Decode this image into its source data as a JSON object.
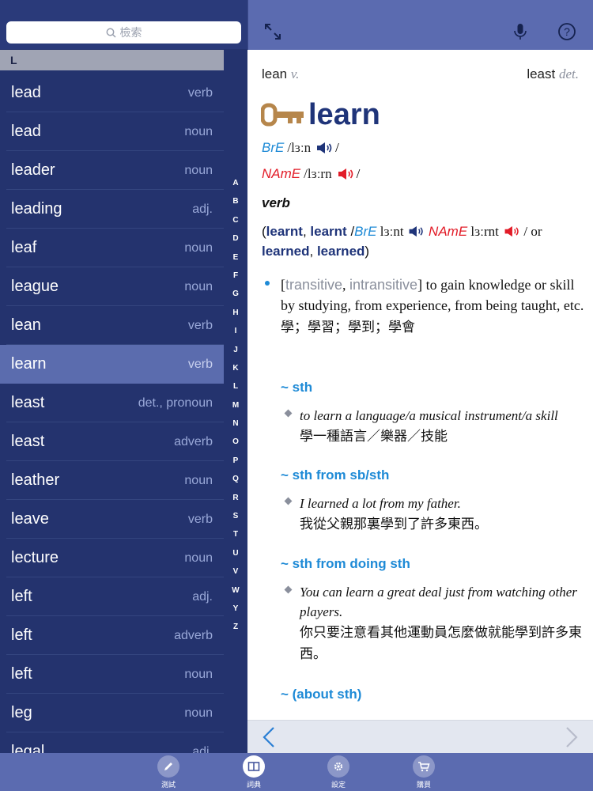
{
  "search": {
    "placeholder": "檢索"
  },
  "section_letter": "L",
  "word_list": [
    {
      "word": "lead",
      "pos": "verb"
    },
    {
      "word": "lead",
      "pos": "noun"
    },
    {
      "word": "leader",
      "pos": "noun"
    },
    {
      "word": "leading",
      "pos": "adj."
    },
    {
      "word": "leaf",
      "pos": "noun"
    },
    {
      "word": "league",
      "pos": "noun"
    },
    {
      "word": "lean",
      "pos": "verb"
    },
    {
      "word": "learn",
      "pos": "verb",
      "selected": true
    },
    {
      "word": "least",
      "pos": "det., pronoun"
    },
    {
      "word": "least",
      "pos": "adverb"
    },
    {
      "word": "leather",
      "pos": "noun"
    },
    {
      "word": "leave",
      "pos": "verb"
    },
    {
      "word": "lecture",
      "pos": "noun"
    },
    {
      "word": "left",
      "pos": "adj."
    },
    {
      "word": "left",
      "pos": "adverb"
    },
    {
      "word": "left",
      "pos": "noun"
    },
    {
      "word": "leg",
      "pos": "noun"
    },
    {
      "word": "legal",
      "pos": "adj."
    }
  ],
  "alphabet": [
    "A",
    "B",
    "C",
    "D",
    "E",
    "F",
    "G",
    "H",
    "I",
    "J",
    "K",
    "L",
    "M",
    "N",
    "O",
    "P",
    "Q",
    "R",
    "S",
    "T",
    "U",
    "V",
    "W",
    "Y",
    "Z"
  ],
  "entry": {
    "prev_word": "lean",
    "prev_pos": "v.",
    "next_word": "least",
    "next_pos": "det.",
    "headword": "learn",
    "bre_label": "BrE",
    "bre_ipa": "/lɜːn",
    "name_label": "NAmE",
    "name_ipa": "/lɜːrn",
    "slash": "/",
    "pos": "verb",
    "forms": {
      "open": "(",
      "past1": "learnt",
      "comma1": ", ",
      "past2": "learnt",
      "slash1": " /",
      "bre": "BrE",
      "bre_ipa": " lɜːnt",
      "name": "NAmE",
      "name_ipa": " lɜːrnt",
      "or": "/ or",
      "past3": "learned",
      "comma2": ", ",
      "past4": "learned",
      "close": ")"
    },
    "sense": {
      "gram_open": "[",
      "gram1": "transitive",
      "gram_sep": ", ",
      "gram2": "intransitive",
      "gram_close": "]",
      "definition": " to gain knowledge or skill by studying, from experience, from being taught, etc.",
      "translation": "學；學習；學到；學會"
    },
    "patterns": [
      {
        "label": "~ sth",
        "example": "to learn a language/a musical instrument/a skill",
        "translation": "學一種語言／樂器／技能"
      },
      {
        "label": "~ sth from sb/sth",
        "example": "I learned a lot from my father.",
        "translation": "我從父親那裏學到了許多東西。"
      },
      {
        "label": "~ sth from doing sth",
        "example": "You can learn a great deal just from watching other players.",
        "translation": "你只要注意看其他運動員怎麼做就能學到許多東西。"
      },
      {
        "label": "~ (about sth)",
        "example": "",
        "translation": ""
      }
    ]
  },
  "tabs": [
    {
      "label": "測試",
      "icon": "pencil-icon"
    },
    {
      "label": "詞典",
      "icon": "book-icon",
      "active": true
    },
    {
      "label": "設定",
      "icon": "gear-icon"
    },
    {
      "label": "購買",
      "icon": "cart-icon"
    }
  ],
  "colors": {
    "sidebar": "#24336e",
    "selected": "#5b6cae",
    "headword": "#1f3479",
    "bre": "#1e8ad6",
    "name": "#e21c28"
  }
}
